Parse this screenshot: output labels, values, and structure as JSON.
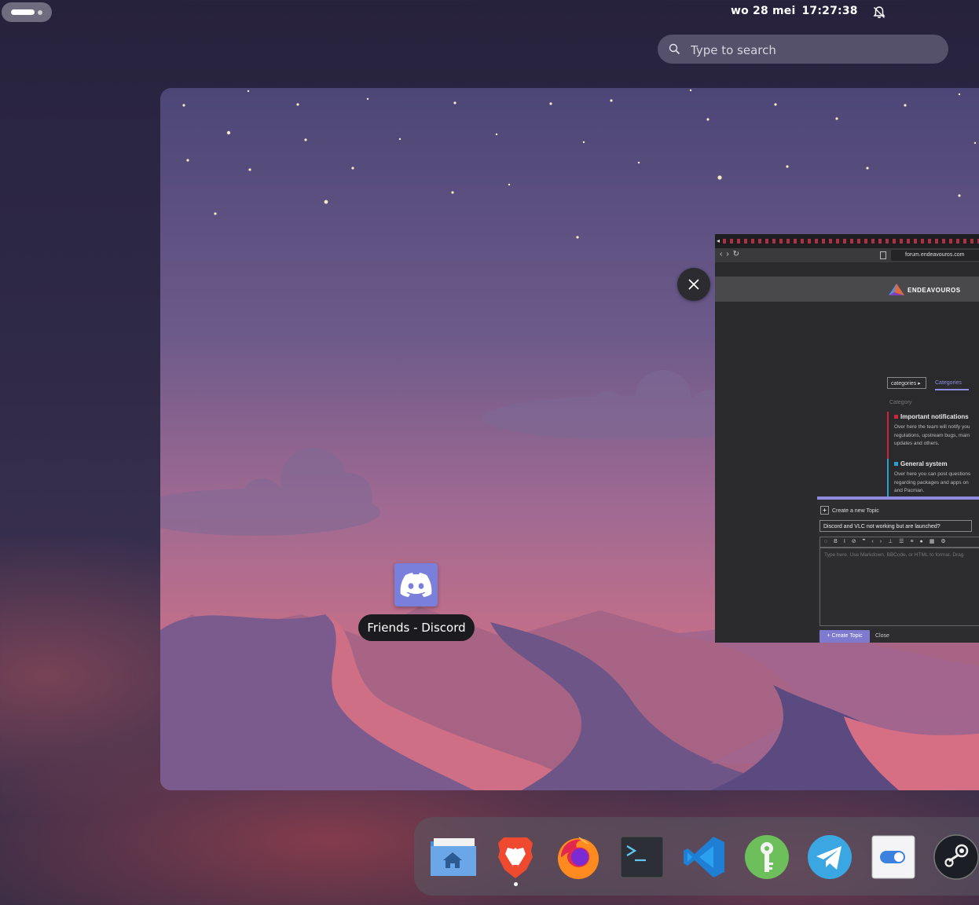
{
  "topbar": {
    "clock_date": "wo 28 mei",
    "clock_time": "17:27:38"
  },
  "search": {
    "placeholder": "Type to search"
  },
  "overview": {
    "window_label": "Friends - Discord",
    "browser": {
      "url": "forum.endeavouros.com",
      "logo_text": "ENDEAVOUROS",
      "category_select": "categories",
      "categories_tab": "Categories",
      "category_label": "Category",
      "categories": [
        {
          "title": "Important notifications",
          "color": "#d0243c",
          "lines": [
            "Over here the team will notify you",
            "regulations, upstream bugs, main",
            "updates and others."
          ]
        },
        {
          "title": "General system",
          "color": "#2a9fd6",
          "lines": [
            "Over here you can post questions",
            "regarding packages and apps on",
            "and Pacman."
          ]
        }
      ],
      "composer": {
        "header": "Create a new Topic",
        "topic_title": "Discord and VLC not working but are launched?",
        "editor_placeholder": "Type here. Use Markdown, BBCode, or HTML to format. Drag",
        "create_button": "Create Topic",
        "close_button": "Close"
      }
    }
  },
  "dock": {
    "apps": [
      "home-folder",
      "brave-browser",
      "firefox",
      "terminal",
      "vscode",
      "keepassxc",
      "telegram",
      "tweaks",
      "steam"
    ]
  },
  "colors": {
    "discord": "#7b7fdc",
    "panel": "#2a2a2c",
    "accent": "#8f8ce0"
  }
}
